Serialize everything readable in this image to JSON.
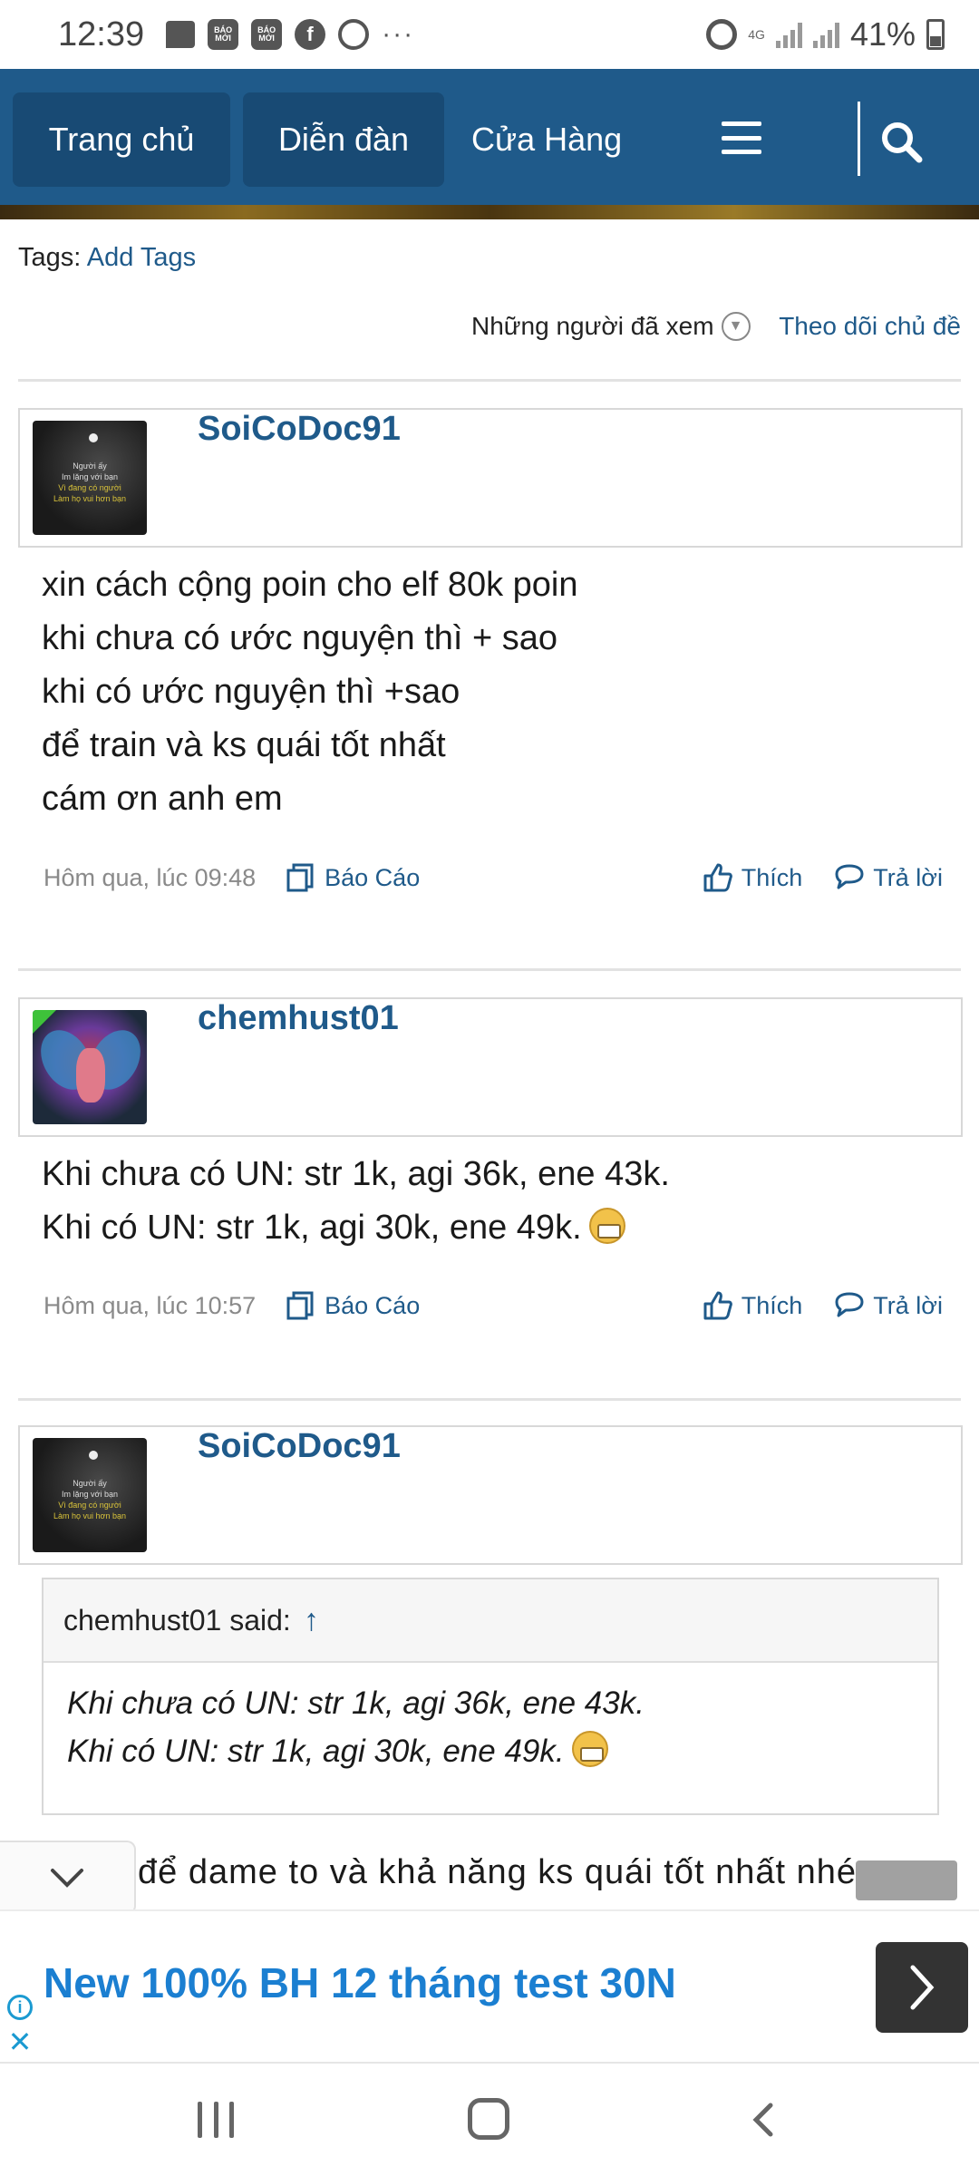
{
  "status_bar": {
    "time": "12:39",
    "notif_icons": [
      "message-icon",
      "baomoi-icon",
      "baomoi-icon",
      "facebook-icon",
      "app-icon"
    ],
    "baomoi_label": "BÁO MỚI",
    "facebook_glyph": "f",
    "more": "···",
    "network": "4G",
    "battery": "41%"
  },
  "nav": {
    "home": "Trang chủ",
    "forum": "Diễn đàn",
    "store": "Cửa Hàng"
  },
  "thread": {
    "tags_label": "Tags:",
    "add_tags": "Add Tags",
    "watchers": "Những người đã xem",
    "follow": "Theo dõi chủ đề"
  },
  "posts": [
    {
      "author": "SoiCoDoc91",
      "avatar_caption": [
        "Người ấy",
        "Im lặng với bạn",
        "Vì đang có người",
        "Làm họ vui hơn bạn"
      ],
      "lines": [
        "xin cách cộng poin cho elf 80k poin",
        "khi chưa có ước nguyện thì + sao",
        "khi có ước nguyện thì +sao",
        "để train và ks quái tốt nhất",
        "cám ơn anh em"
      ],
      "time": "Hôm qua, lúc 09:48",
      "report": "Báo Cáo",
      "like": "Thích",
      "reply": "Trả lời"
    },
    {
      "author": "chemhust01",
      "lines": [
        "Khi chưa có UN: str 1k, agi 36k, ene 43k.",
        "Khi có UN: str 1k, agi 30k, ene 49k."
      ],
      "time": "Hôm qua, lúc 10:57",
      "report": "Báo Cáo",
      "like": "Thích",
      "reply": "Trả lời"
    },
    {
      "author": "SoiCoDoc91",
      "quote": {
        "header": "chemhust01 said:",
        "arrow": "↑",
        "lines": [
          "Khi chưa có UN: str 1k, agi 36k, ene 43k.",
          "Khi có UN: str 1k, agi 30k, ene 49k."
        ]
      },
      "partial_line": "để dame to và khả năng ks quái tốt nhất nhé"
    }
  ],
  "ad": {
    "title": "New 100% BH 12 tháng test 30N",
    "info_glyph": "i",
    "close_glyph": "✕"
  },
  "colors": {
    "nav_bg": "#1f5a8a",
    "nav_tab_active": "#184a74",
    "link": "#1f5a8a",
    "ad_title": "#1b7fd1"
  }
}
